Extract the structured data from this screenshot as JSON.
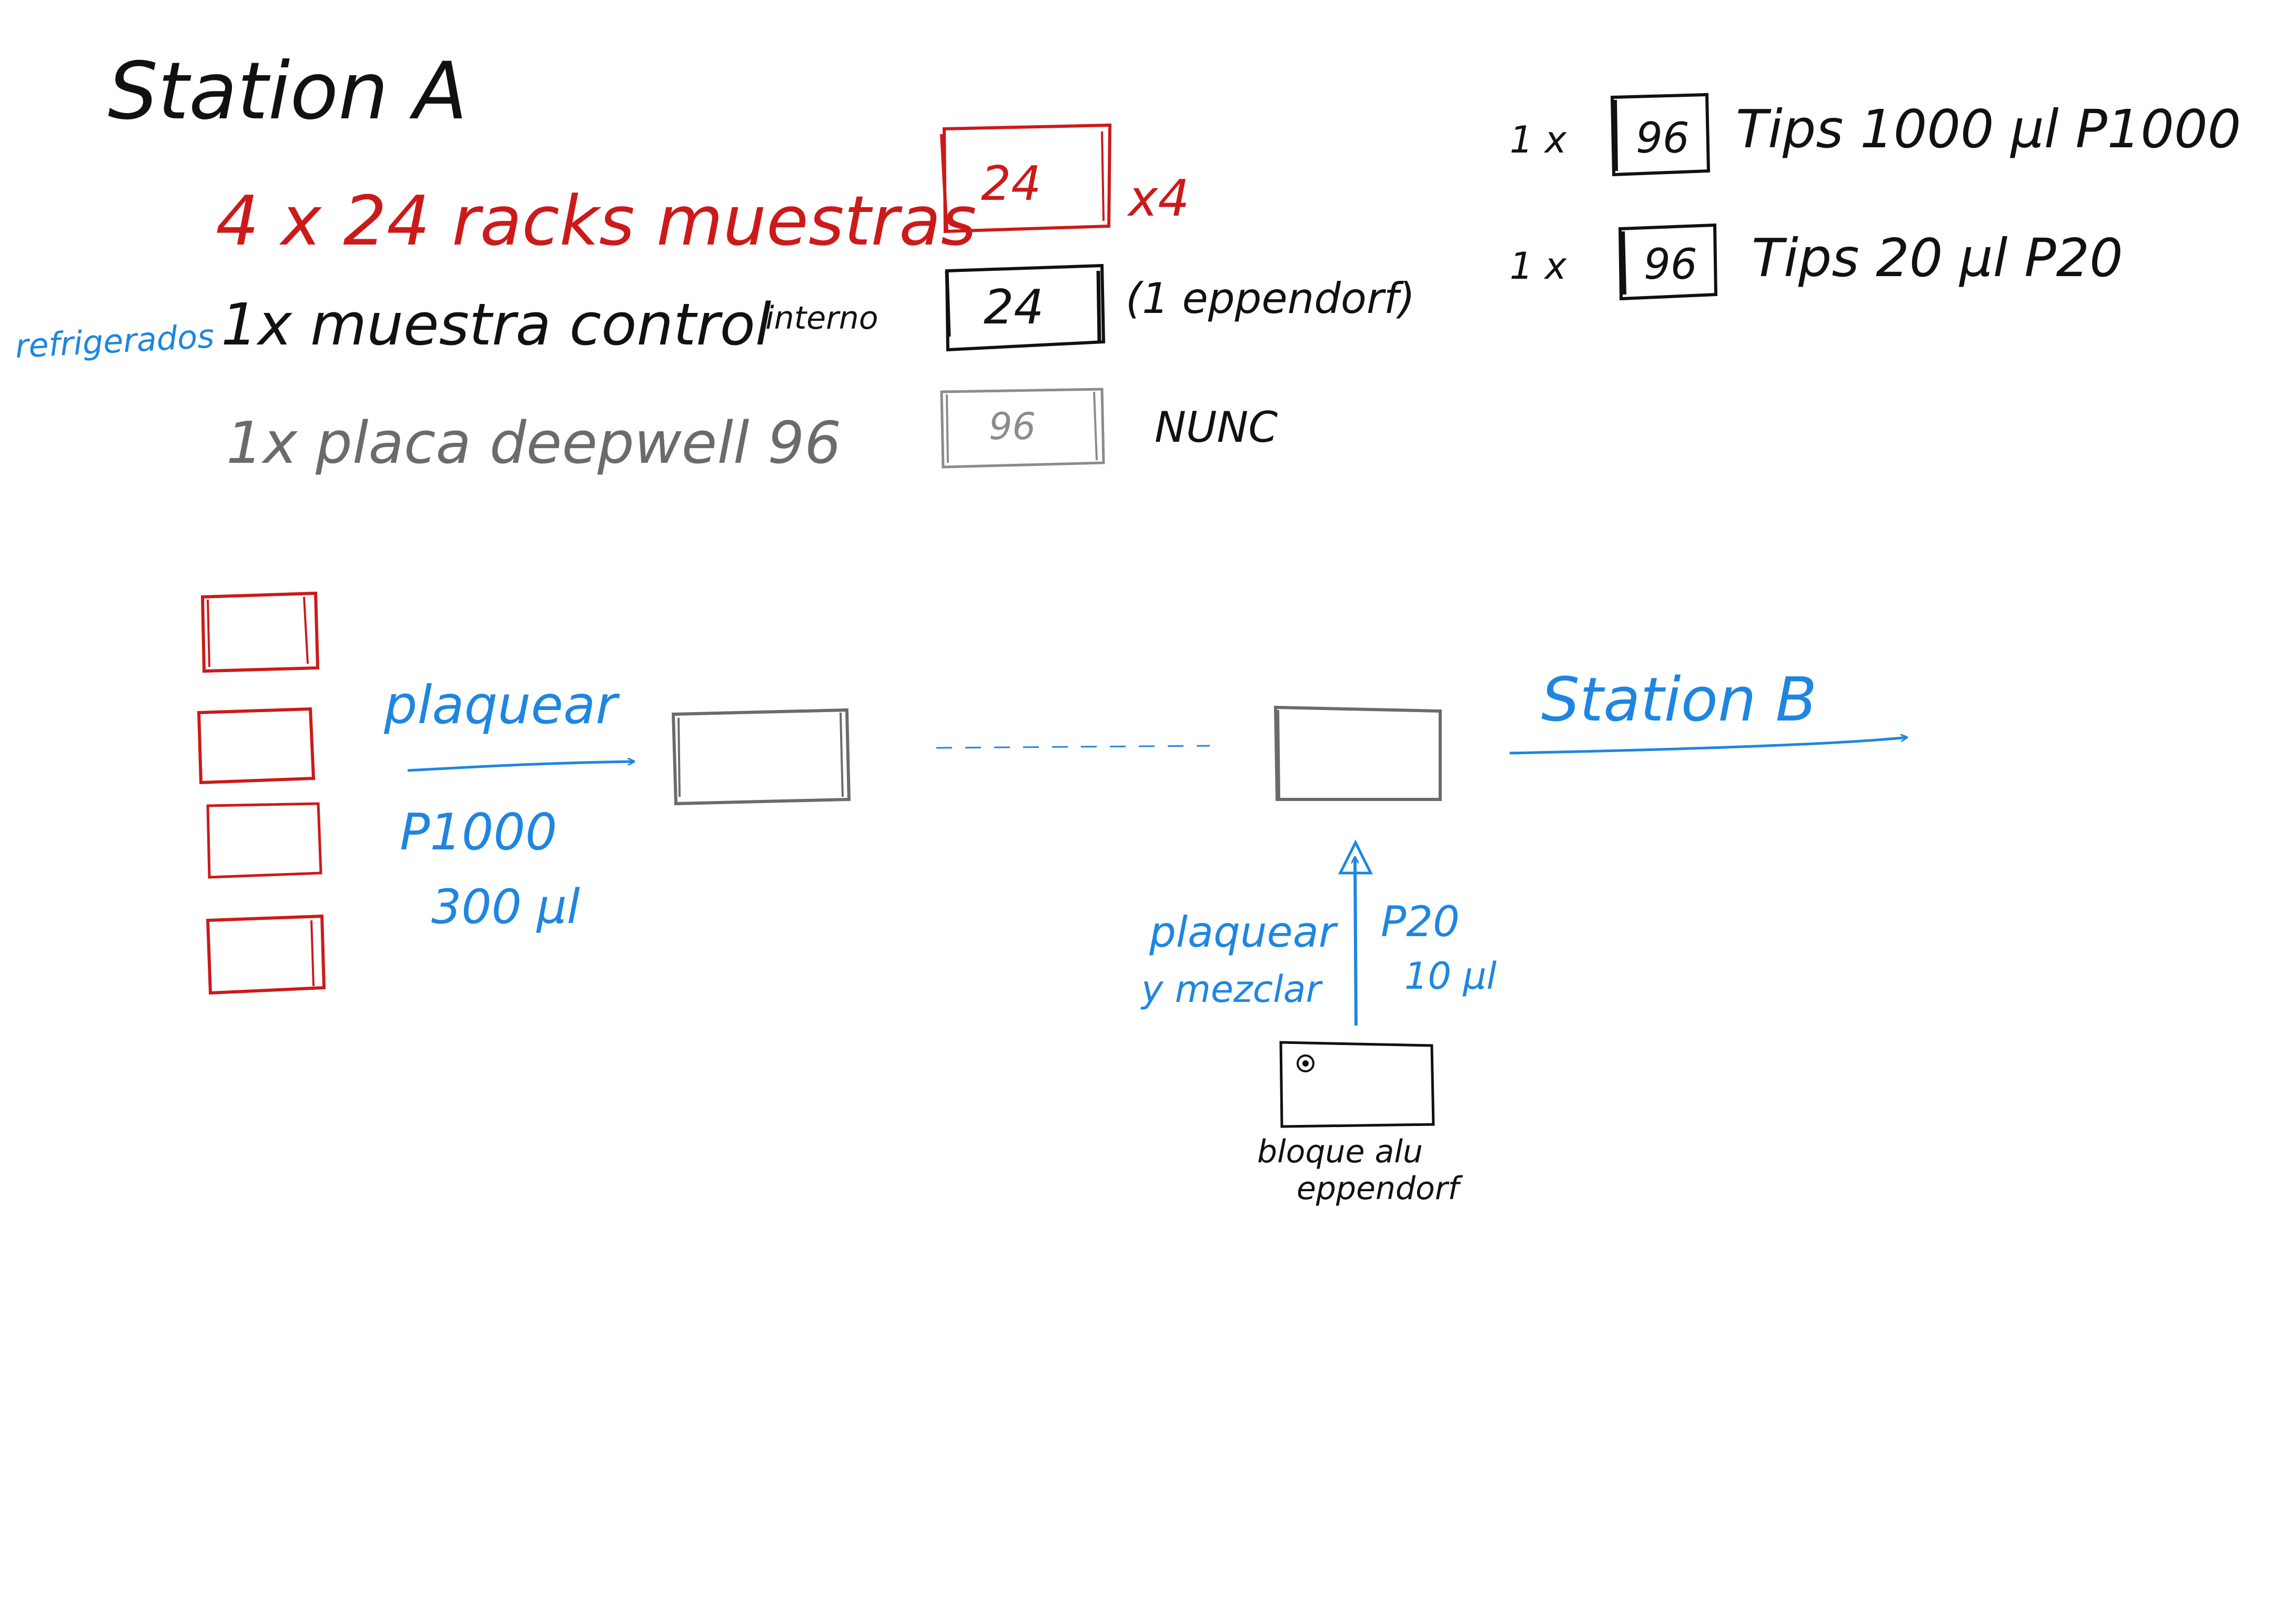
{
  "title": "Station A",
  "colors": {
    "red": "#cc1a1a",
    "black": "#111111",
    "gray": "#6b6b6b",
    "lightgray": "#8c8c8c",
    "blue": "#1f86e0"
  },
  "legend": {
    "samples_line": "4 x 24 racks muestras",
    "control_line": "1x muestra control",
    "control_suffix": "interno",
    "plate_line": "1x placa deepwell 96",
    "refrigerated_note": "refrigerados",
    "samples_box": "24",
    "samples_multiplier": "x4",
    "control_box": "24",
    "control_note": "(1 eppendorf)",
    "plate_box": "96",
    "plate_note": "NUNC"
  },
  "tips": [
    {
      "qty": "1 x",
      "box": "96",
      "label": "Tips 1000 µl P1000"
    },
    {
      "qty": "1 x",
      "box": "96",
      "label": "Tips 20 µl P20"
    }
  ],
  "flow": {
    "step1_label": "plaquear",
    "step1_pipette": "P1000",
    "step1_volume": "300 µl",
    "destination": "Station B",
    "step2_label_line1": "plaquear",
    "step2_label_line2": "y mezclar",
    "step2_pipette": "P20",
    "step2_volume": "10 µl",
    "block_label_line1": "bloque alu",
    "block_label_line2": "eppendorf"
  }
}
